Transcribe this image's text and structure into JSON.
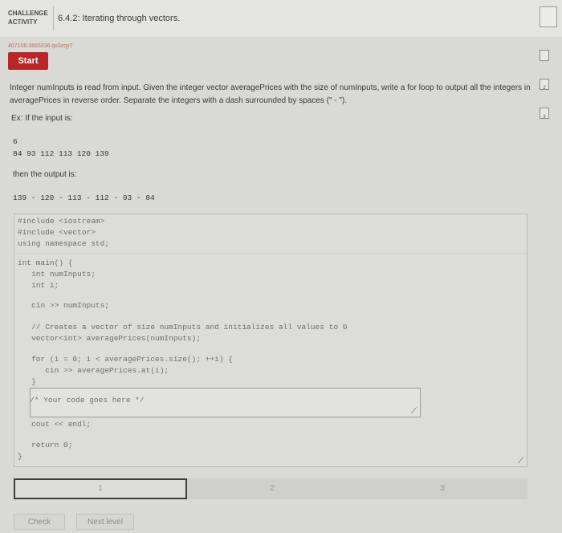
{
  "header": {
    "badge_line1": "CHALLENGE",
    "badge_line2": "ACTIVITY",
    "title": "6.4.2: Iterating through vectors."
  },
  "activity_id": "407106.3665336.qx3zqy7",
  "start_label": "Start",
  "description": {
    "paragraph": "Integer numInputs is read from input. Given the integer vector averagePrices with the size of numInputs, write a for loop to output all the integers in averagePrices in reverse order. Separate the integers with a dash surrounded by spaces (\" - \").",
    "example_intro": "Ex: If the input is:",
    "input_line1": "6",
    "input_line2": "84 93 112 113 120 139",
    "output_intro": "then the output is:",
    "output_line": "139 - 120 - 113 - 112 - 93 - 84"
  },
  "code": {
    "l1": "#include <iostream>",
    "l2": "#include <vector>",
    "l3": "using namespace std;",
    "l4": "int main() {",
    "l5": "   int numInputs;",
    "l6": "   int i;",
    "l7": "   cin >> numInputs;",
    "l8": "   // Creates a vector of size numInputs and initializes all values to 0",
    "l9": "   vector<int> averagePrices(numInputs);",
    "l10": "   for (i = 0; i < averagePrices.size(); ++i) {",
    "l11": "      cin >> averagePrices.at(i);",
    "l12": "   }",
    "student": "   /* Your code goes here */",
    "l13": "   cout << endl;",
    "l14": "   return 0;",
    "l15": "}"
  },
  "progress": {
    "seg1": "1",
    "seg2": "2",
    "seg3": "3"
  },
  "buttons": {
    "check": "Check",
    "next": "Next level"
  },
  "side_icons": {
    "icon2": "2",
    "icon3": "3"
  }
}
